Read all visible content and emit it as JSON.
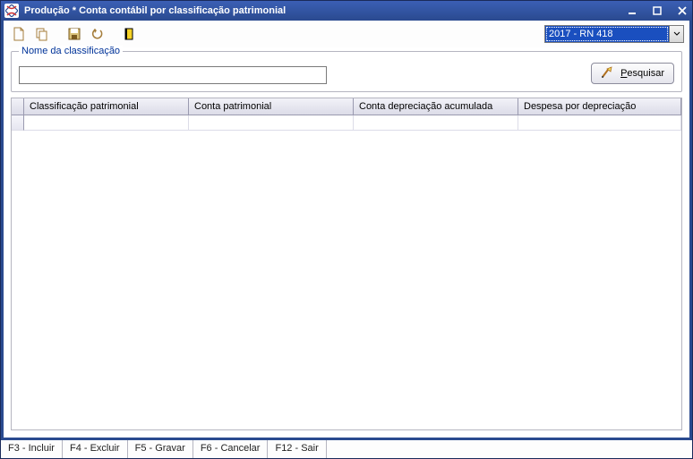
{
  "window": {
    "title": "Produção * Conta contábil por classificação patrimonial"
  },
  "toolbar": {
    "combo_selected": "2017 - RN 418"
  },
  "search": {
    "label": "Nome da classificação",
    "value": "",
    "button_label": "Pesquisar"
  },
  "grid": {
    "columns": [
      "Classificação patrimonial",
      "Conta patrimonial",
      "Conta depreciação acumulada",
      "Despesa por depreciação"
    ],
    "rows": [
      [
        "",
        "",
        "",
        ""
      ]
    ]
  },
  "statusbar": {
    "items": [
      "F3 - Incluir",
      "F4 - Excluir",
      "F5 - Gravar",
      "F6 - Cancelar",
      "F12 - Sair"
    ]
  }
}
